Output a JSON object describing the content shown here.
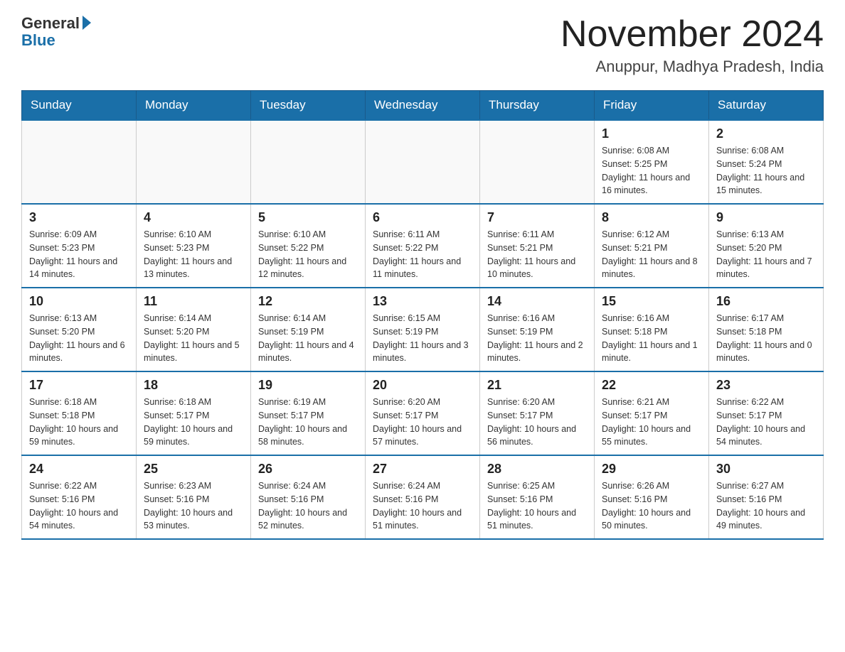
{
  "header": {
    "logo_general": "General",
    "logo_blue": "Blue",
    "month_title": "November 2024",
    "location": "Anuppur, Madhya Pradesh, India"
  },
  "weekdays": [
    "Sunday",
    "Monday",
    "Tuesday",
    "Wednesday",
    "Thursday",
    "Friday",
    "Saturday"
  ],
  "weeks": [
    [
      {
        "day": "",
        "info": ""
      },
      {
        "day": "",
        "info": ""
      },
      {
        "day": "",
        "info": ""
      },
      {
        "day": "",
        "info": ""
      },
      {
        "day": "",
        "info": ""
      },
      {
        "day": "1",
        "info": "Sunrise: 6:08 AM\nSunset: 5:25 PM\nDaylight: 11 hours and 16 minutes."
      },
      {
        "day": "2",
        "info": "Sunrise: 6:08 AM\nSunset: 5:24 PM\nDaylight: 11 hours and 15 minutes."
      }
    ],
    [
      {
        "day": "3",
        "info": "Sunrise: 6:09 AM\nSunset: 5:23 PM\nDaylight: 11 hours and 14 minutes."
      },
      {
        "day": "4",
        "info": "Sunrise: 6:10 AM\nSunset: 5:23 PM\nDaylight: 11 hours and 13 minutes."
      },
      {
        "day": "5",
        "info": "Sunrise: 6:10 AM\nSunset: 5:22 PM\nDaylight: 11 hours and 12 minutes."
      },
      {
        "day": "6",
        "info": "Sunrise: 6:11 AM\nSunset: 5:22 PM\nDaylight: 11 hours and 11 minutes."
      },
      {
        "day": "7",
        "info": "Sunrise: 6:11 AM\nSunset: 5:21 PM\nDaylight: 11 hours and 10 minutes."
      },
      {
        "day": "8",
        "info": "Sunrise: 6:12 AM\nSunset: 5:21 PM\nDaylight: 11 hours and 8 minutes."
      },
      {
        "day": "9",
        "info": "Sunrise: 6:13 AM\nSunset: 5:20 PM\nDaylight: 11 hours and 7 minutes."
      }
    ],
    [
      {
        "day": "10",
        "info": "Sunrise: 6:13 AM\nSunset: 5:20 PM\nDaylight: 11 hours and 6 minutes."
      },
      {
        "day": "11",
        "info": "Sunrise: 6:14 AM\nSunset: 5:20 PM\nDaylight: 11 hours and 5 minutes."
      },
      {
        "day": "12",
        "info": "Sunrise: 6:14 AM\nSunset: 5:19 PM\nDaylight: 11 hours and 4 minutes."
      },
      {
        "day": "13",
        "info": "Sunrise: 6:15 AM\nSunset: 5:19 PM\nDaylight: 11 hours and 3 minutes."
      },
      {
        "day": "14",
        "info": "Sunrise: 6:16 AM\nSunset: 5:19 PM\nDaylight: 11 hours and 2 minutes."
      },
      {
        "day": "15",
        "info": "Sunrise: 6:16 AM\nSunset: 5:18 PM\nDaylight: 11 hours and 1 minute."
      },
      {
        "day": "16",
        "info": "Sunrise: 6:17 AM\nSunset: 5:18 PM\nDaylight: 11 hours and 0 minutes."
      }
    ],
    [
      {
        "day": "17",
        "info": "Sunrise: 6:18 AM\nSunset: 5:18 PM\nDaylight: 10 hours and 59 minutes."
      },
      {
        "day": "18",
        "info": "Sunrise: 6:18 AM\nSunset: 5:17 PM\nDaylight: 10 hours and 59 minutes."
      },
      {
        "day": "19",
        "info": "Sunrise: 6:19 AM\nSunset: 5:17 PM\nDaylight: 10 hours and 58 minutes."
      },
      {
        "day": "20",
        "info": "Sunrise: 6:20 AM\nSunset: 5:17 PM\nDaylight: 10 hours and 57 minutes."
      },
      {
        "day": "21",
        "info": "Sunrise: 6:20 AM\nSunset: 5:17 PM\nDaylight: 10 hours and 56 minutes."
      },
      {
        "day": "22",
        "info": "Sunrise: 6:21 AM\nSunset: 5:17 PM\nDaylight: 10 hours and 55 minutes."
      },
      {
        "day": "23",
        "info": "Sunrise: 6:22 AM\nSunset: 5:17 PM\nDaylight: 10 hours and 54 minutes."
      }
    ],
    [
      {
        "day": "24",
        "info": "Sunrise: 6:22 AM\nSunset: 5:16 PM\nDaylight: 10 hours and 54 minutes."
      },
      {
        "day": "25",
        "info": "Sunrise: 6:23 AM\nSunset: 5:16 PM\nDaylight: 10 hours and 53 minutes."
      },
      {
        "day": "26",
        "info": "Sunrise: 6:24 AM\nSunset: 5:16 PM\nDaylight: 10 hours and 52 minutes."
      },
      {
        "day": "27",
        "info": "Sunrise: 6:24 AM\nSunset: 5:16 PM\nDaylight: 10 hours and 51 minutes."
      },
      {
        "day": "28",
        "info": "Sunrise: 6:25 AM\nSunset: 5:16 PM\nDaylight: 10 hours and 51 minutes."
      },
      {
        "day": "29",
        "info": "Sunrise: 6:26 AM\nSunset: 5:16 PM\nDaylight: 10 hours and 50 minutes."
      },
      {
        "day": "30",
        "info": "Sunrise: 6:27 AM\nSunset: 5:16 PM\nDaylight: 10 hours and 49 minutes."
      }
    ]
  ]
}
